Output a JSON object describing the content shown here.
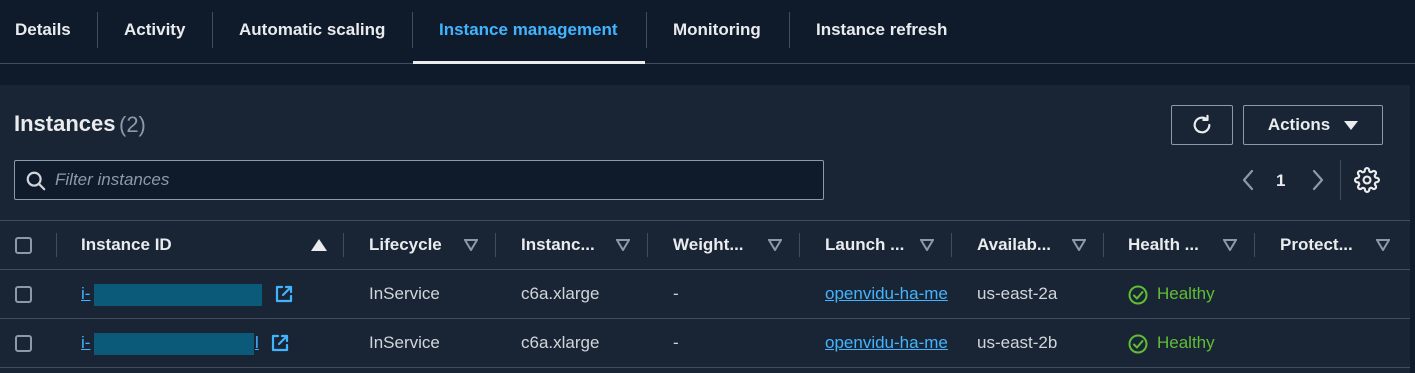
{
  "tabs": [
    {
      "label": "Details"
    },
    {
      "label": "Activity"
    },
    {
      "label": "Automatic scaling"
    },
    {
      "label": "Instance management",
      "active": true
    },
    {
      "label": "Monitoring"
    },
    {
      "label": "Instance refresh"
    }
  ],
  "header": {
    "title": "Instances",
    "count": "(2)"
  },
  "toolbar": {
    "actions_label": "Actions"
  },
  "search": {
    "placeholder": "Filter instances",
    "value": ""
  },
  "pagination": {
    "current_page": "1"
  },
  "table": {
    "columns": [
      "Instance ID",
      "Lifecycle",
      "Instanc...",
      "Weight...",
      "Launch ...",
      "Availab...",
      "Health ...",
      "Protect..."
    ],
    "rows": [
      {
        "instance_id": "i-",
        "instance_id_tail": "",
        "lifecycle": "InService",
        "instance_type": "c6a.xlarge",
        "weight": "-",
        "launch": "openvidu-ha-me",
        "az": "us-east-2a",
        "health": "Healthy",
        "protect": ""
      },
      {
        "instance_id": "i-",
        "instance_id_tail": "l",
        "lifecycle": "InService",
        "instance_type": "c6a.xlarge",
        "weight": "-",
        "launch": "openvidu-ha-me",
        "az": "us-east-2b",
        "health": "Healthy",
        "protect": ""
      }
    ]
  },
  "colors": {
    "accent": "#42b4ff",
    "healthy": "#5fbe35",
    "background": "#0f1b2a",
    "panel": "#192534"
  }
}
